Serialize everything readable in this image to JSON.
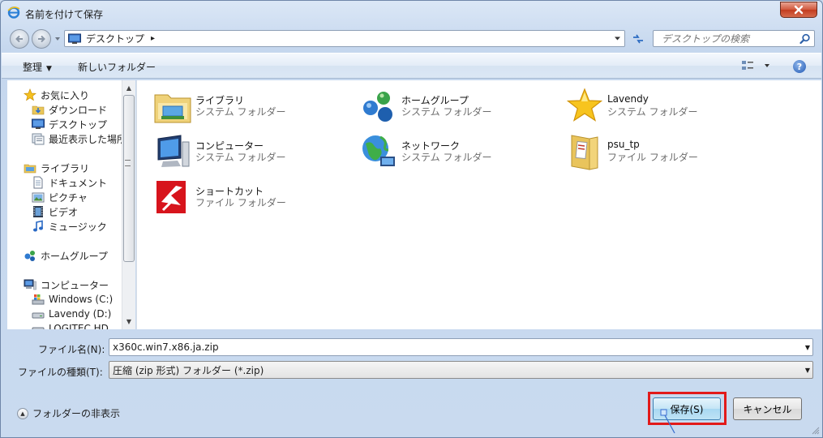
{
  "window": {
    "title": "名前を付けて保存"
  },
  "address": {
    "location": "デスクトップ",
    "separator": "▸"
  },
  "search": {
    "placeholder": "デスクトップの検索"
  },
  "toolbar": {
    "organize_label": "整理",
    "new_folder_label": "新しいフォルダー"
  },
  "nav": {
    "favorites": {
      "label": "お気に入り",
      "items": [
        "ダウンロード",
        "デスクトップ",
        "最近表示した場所"
      ]
    },
    "libraries": {
      "label": "ライブラリ",
      "items": [
        "ドキュメント",
        "ピクチャ",
        "ビデオ",
        "ミュージック"
      ]
    },
    "homegroup": {
      "label": "ホームグループ"
    },
    "computer": {
      "label": "コンピューター",
      "items": [
        "Windows (C:)",
        "Lavendy (D:)",
        "LOGITEC HD"
      ]
    }
  },
  "content": {
    "items": [
      {
        "name": "ライブラリ",
        "type": "システム フォルダー",
        "icon": "library-icon"
      },
      {
        "name": "ホームグループ",
        "type": "システム フォルダー",
        "icon": "homegroup-icon"
      },
      {
        "name": "Lavendy",
        "type": "システム フォルダー",
        "icon": "star-user-icon"
      },
      {
        "name": "コンピューター",
        "type": "システム フォルダー",
        "icon": "computer-icon"
      },
      {
        "name": "ネットワーク",
        "type": "システム フォルダー",
        "icon": "network-icon"
      },
      {
        "name": "psu_tp",
        "type": "ファイル フォルダー",
        "icon": "folder-icon"
      },
      {
        "name": "ショートカット",
        "type": "ファイル フォルダー",
        "icon": "shortcut-icon"
      }
    ]
  },
  "form": {
    "filename_label": "ファイル名(N):",
    "filename_value": "x360c.win7.x86.ja.zip",
    "filetype_label": "ファイルの種類(T):",
    "filetype_value": "圧縮 (zip 形式) フォルダー (*.zip)"
  },
  "footer": {
    "hide_folders_label": "フォルダーの非表示",
    "save_label": "保存(S)",
    "cancel_label": "キャンセル"
  },
  "colors": {
    "highlight": "#e21a1a",
    "window_frame": "#c9daef"
  }
}
